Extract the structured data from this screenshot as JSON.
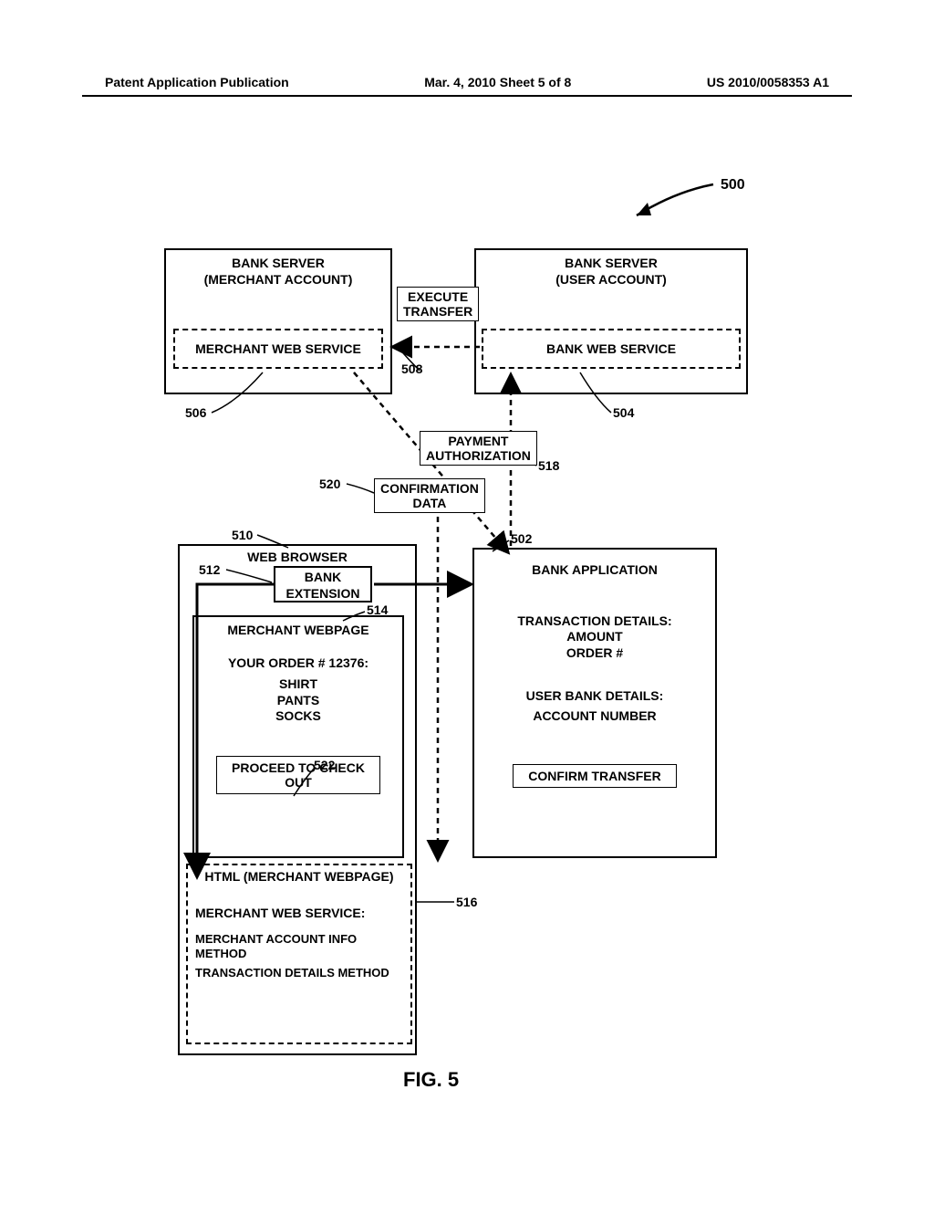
{
  "header": {
    "left": "Patent Application Publication",
    "center": "Mar. 4, 2010   Sheet 5 of 8",
    "right": "US 2010/0058353 A1"
  },
  "refs": {
    "r500": "500",
    "r502": "502",
    "r504": "504",
    "r506": "506",
    "r508": "508",
    "r510": "510",
    "r512": "512",
    "r514": "514",
    "r516": "516",
    "r518": "518",
    "r520": "520",
    "r522": "522"
  },
  "labels": {
    "execute_transfer": "EXECUTE\nTRANSFER",
    "payment_authorization": "PAYMENT\nAUTHORIZATION",
    "confirmation_data": "CONFIRMATION\nDATA"
  },
  "boxes": {
    "bank_server_merchant": "BANK SERVER\n(MERCHANT ACCOUNT)",
    "bank_server_user": "BANK SERVER\n(USER ACCOUNT)",
    "merchant_web_service": "MERCHANT WEB SERVICE",
    "bank_web_service": "BANK WEB SERVICE",
    "web_browser": "WEB BROWSER",
    "bank_extension": "BANK\nEXTENSION",
    "merchant_webpage": "MERCHANT WEBPAGE",
    "order_line": "YOUR ORDER # 12376:",
    "items": [
      "SHIRT",
      "PANTS",
      "SOCKS"
    ],
    "proceed_checkout": "PROCEED TO CHECK\nOUT",
    "html_merchant": "HTML (MERCHANT WEBPAGE)",
    "merchant_ws_block": "MERCHANT WEB SERVICE:",
    "merchant_ws_m1": "MERCHANT ACCOUNT INFO METHOD",
    "merchant_ws_m2": "TRANSACTION DETAILS METHOD",
    "bank_application": "BANK APPLICATION",
    "tx_details": "TRANSACTION DETAILS:",
    "tx_amount": "AMOUNT",
    "tx_order": "ORDER #",
    "user_bank_details": "USER BANK DETAILS:",
    "account_number": "ACCOUNT NUMBER",
    "confirm_transfer": "CONFIRM TRANSFER"
  },
  "figure": "FIG. 5"
}
